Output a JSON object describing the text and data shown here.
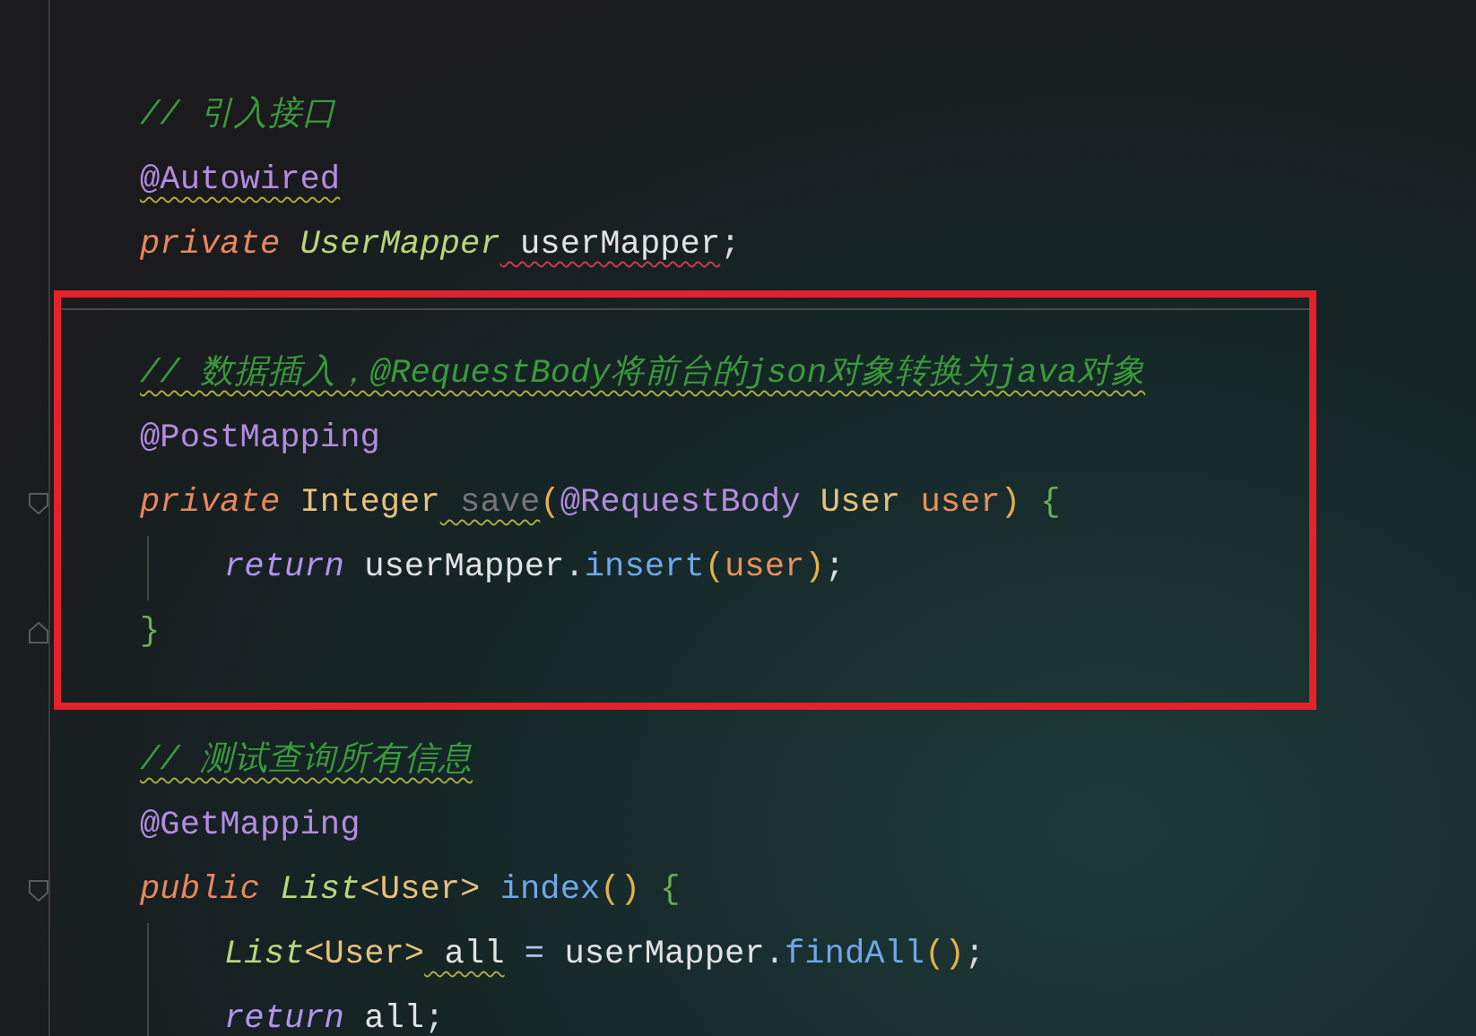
{
  "blocks": [
    {
      "lines": [
        {
          "tokens": [
            {
              "text": "// 引入接口",
              "kind": "comment"
            }
          ]
        },
        {
          "tokens": [
            {
              "text": "@Autowired",
              "kind": "annotation",
              "warning": true
            }
          ]
        },
        {
          "tokens": [
            {
              "text": "private",
              "kind": "keyword"
            },
            {
              "text": " UserMapper",
              "kind": "type-italic"
            },
            {
              "text": " userMapper",
              "kind": "variable",
              "error": true
            },
            {
              "text": ";",
              "kind": "plain"
            }
          ]
        }
      ]
    },
    {
      "boxed": true,
      "lines": [
        {
          "tokens": [
            {
              "text": "// 数据插入，@RequestBody将前台的json对象转换为java对象",
              "kind": "comment",
              "warning": true
            }
          ]
        },
        {
          "tokens": [
            {
              "text": "@PostMapping",
              "kind": "annotation"
            }
          ]
        },
        {
          "fold_start": true,
          "tokens": [
            {
              "text": "private",
              "kind": "keyword"
            },
            {
              "text": " Integer",
              "kind": "type"
            },
            {
              "text": " save",
              "kind": "unused",
              "warning": true
            },
            {
              "text": "(",
              "kind": "paren"
            },
            {
              "text": "@RequestBody",
              "kind": "annotation"
            },
            {
              "text": " User",
              "kind": "type"
            },
            {
              "text": " user",
              "kind": "parameter"
            },
            {
              "text": ")",
              "kind": "paren"
            },
            {
              "text": " {",
              "kind": "brace"
            }
          ],
          "children": [
            {
              "tokens": [
                {
                  "text": "return",
                  "kind": "keyword-return"
                },
                {
                  "text": " userMapper",
                  "kind": "variable"
                },
                {
                  "text": ".",
                  "kind": "plain"
                },
                {
                  "text": "insert",
                  "kind": "method"
                },
                {
                  "text": "(",
                  "kind": "paren"
                },
                {
                  "text": "user",
                  "kind": "parameter"
                },
                {
                  "text": ")",
                  "kind": "paren"
                },
                {
                  "text": ";",
                  "kind": "plain"
                }
              ]
            }
          ]
        },
        {
          "fold_end": true,
          "tokens": [
            {
              "text": "}",
              "kind": "brace"
            }
          ]
        }
      ]
    },
    {
      "lines": [
        {
          "tokens": [
            {
              "text": "// 测试查询所有信息",
              "kind": "comment",
              "warning": true
            }
          ]
        },
        {
          "tokens": [
            {
              "text": "@GetMapping",
              "kind": "annotation"
            }
          ]
        },
        {
          "fold_start": true,
          "tokens": [
            {
              "text": "public",
              "kind": "keyword"
            },
            {
              "text": " List",
              "kind": "type-italic"
            },
            {
              "text": "<User>",
              "kind": "type"
            },
            {
              "text": " index",
              "kind": "method"
            },
            {
              "text": "()",
              "kind": "paren"
            },
            {
              "text": " {",
              "kind": "brace"
            }
          ],
          "children": [
            {
              "tokens": [
                {
                  "text": "List",
                  "kind": "type-italic"
                },
                {
                  "text": "<User>",
                  "kind": "type"
                },
                {
                  "text": " all",
                  "kind": "variable",
                  "warning": true
                },
                {
                  "text": " =",
                  "kind": "operator"
                },
                {
                  "text": " userMapper",
                  "kind": "variable"
                },
                {
                  "text": ".",
                  "kind": "plain"
                },
                {
                  "text": "findAll",
                  "kind": "method"
                },
                {
                  "text": "()",
                  "kind": "paren"
                },
                {
                  "text": ";",
                  "kind": "plain"
                }
              ]
            },
            {
              "tokens": [
                {
                  "text": "return",
                  "kind": "keyword-return"
                },
                {
                  "text": " all",
                  "kind": "variable"
                },
                {
                  "text": ";",
                  "kind": "plain"
                }
              ]
            }
          ]
        }
      ]
    }
  ]
}
